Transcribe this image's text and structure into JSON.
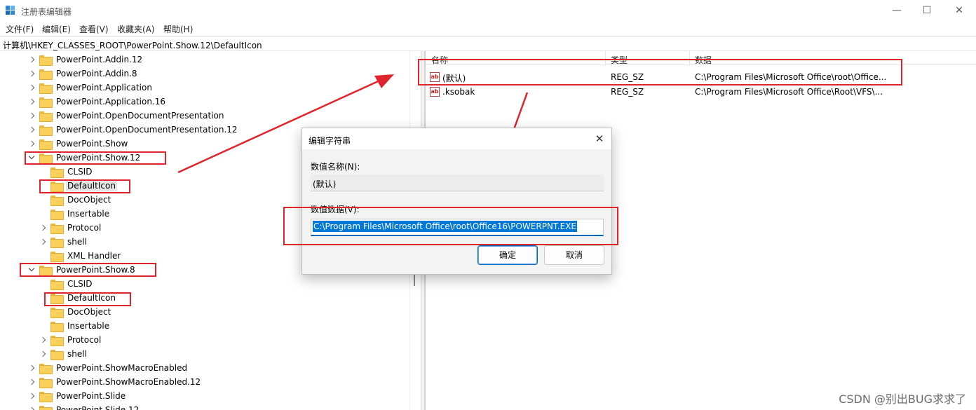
{
  "window": {
    "title": "注册表编辑器",
    "minimize": "—",
    "maximize": "☐",
    "close": "✕"
  },
  "menu": [
    "文件(F)",
    "编辑(E)",
    "查看(V)",
    "收藏夹(A)",
    "帮助(H)"
  ],
  "address": "计算机\\HKEY_CLASSES_ROOT\\PowerPoint.Show.12\\DefaultIcon",
  "tree": [
    {
      "label": "PowerPoint.Addin.12",
      "level": 0,
      "expander": "right",
      "selected": false
    },
    {
      "label": "PowerPoint.Addin.8",
      "level": 0,
      "expander": "right",
      "selected": false
    },
    {
      "label": "PowerPoint.Application",
      "level": 0,
      "expander": "right",
      "selected": false
    },
    {
      "label": "PowerPoint.Application.16",
      "level": 0,
      "expander": "right",
      "selected": false
    },
    {
      "label": "PowerPoint.OpenDocumentPresentation",
      "level": 0,
      "expander": "right",
      "selected": false
    },
    {
      "label": "PowerPoint.OpenDocumentPresentation.12",
      "level": 0,
      "expander": "right",
      "selected": false
    },
    {
      "label": "PowerPoint.Show",
      "level": 0,
      "expander": "right",
      "selected": false
    },
    {
      "label": "PowerPoint.Show.12",
      "level": 0,
      "expander": "down",
      "selected": false
    },
    {
      "label": "CLSID",
      "level": 1,
      "expander": "none",
      "selected": false
    },
    {
      "label": "DefaultIcon",
      "level": 1,
      "expander": "none",
      "selected": true
    },
    {
      "label": "DocObject",
      "level": 1,
      "expander": "none",
      "selected": false
    },
    {
      "label": "Insertable",
      "level": 1,
      "expander": "none",
      "selected": false
    },
    {
      "label": "Protocol",
      "level": 1,
      "expander": "right",
      "selected": false
    },
    {
      "label": "shell",
      "level": 1,
      "expander": "right",
      "selected": false
    },
    {
      "label": "XML Handler",
      "level": 1,
      "expander": "none",
      "selected": false
    },
    {
      "label": "PowerPoint.Show.8",
      "level": 0,
      "expander": "down",
      "selected": false
    },
    {
      "label": "CLSID",
      "level": 1,
      "expander": "none",
      "selected": false
    },
    {
      "label": "DefaultIcon",
      "level": 1,
      "expander": "none",
      "selected": false
    },
    {
      "label": "DocObject",
      "level": 1,
      "expander": "none",
      "selected": false
    },
    {
      "label": "Insertable",
      "level": 1,
      "expander": "none",
      "selected": false
    },
    {
      "label": "Protocol",
      "level": 1,
      "expander": "right",
      "selected": false
    },
    {
      "label": "shell",
      "level": 1,
      "expander": "right",
      "selected": false
    },
    {
      "label": "PowerPoint.ShowMacroEnabled",
      "level": 0,
      "expander": "right",
      "selected": false
    },
    {
      "label": "PowerPoint.ShowMacroEnabled.12",
      "level": 0,
      "expander": "right",
      "selected": false
    },
    {
      "label": "PowerPoint.Slide",
      "level": 0,
      "expander": "right",
      "selected": false
    },
    {
      "label": "PowerPoint.Slide.12",
      "level": 0,
      "expander": "right",
      "selected": false
    }
  ],
  "list": {
    "columns": [
      "名称",
      "类型",
      "数据"
    ],
    "rows": [
      {
        "icon": "ab",
        "name": "(默认)",
        "type": "REG_SZ",
        "data": "C:\\Program Files\\Microsoft Office\\root\\Office..."
      },
      {
        "icon": "ab",
        "name": ".ksobak",
        "type": "REG_SZ",
        "data": "C:\\Program Files\\Microsoft Office\\Root\\VFS\\..."
      }
    ]
  },
  "dialog": {
    "title": "编辑字符串",
    "name_label": "数值名称(N):",
    "name_value": "(默认)",
    "data_label": "数值数据(V):",
    "data_value": "C:\\Program Files\\Microsoft Office\\root\\Office16\\POWERPNT.EXE",
    "ok": "确定",
    "cancel": "取消"
  },
  "watermark": "CSDN @别出BUG求求了",
  "colors": {
    "annotation_red": "#e0242c",
    "selection_blue": "#0078d7",
    "folder_yellow": "#f8cf5b"
  }
}
